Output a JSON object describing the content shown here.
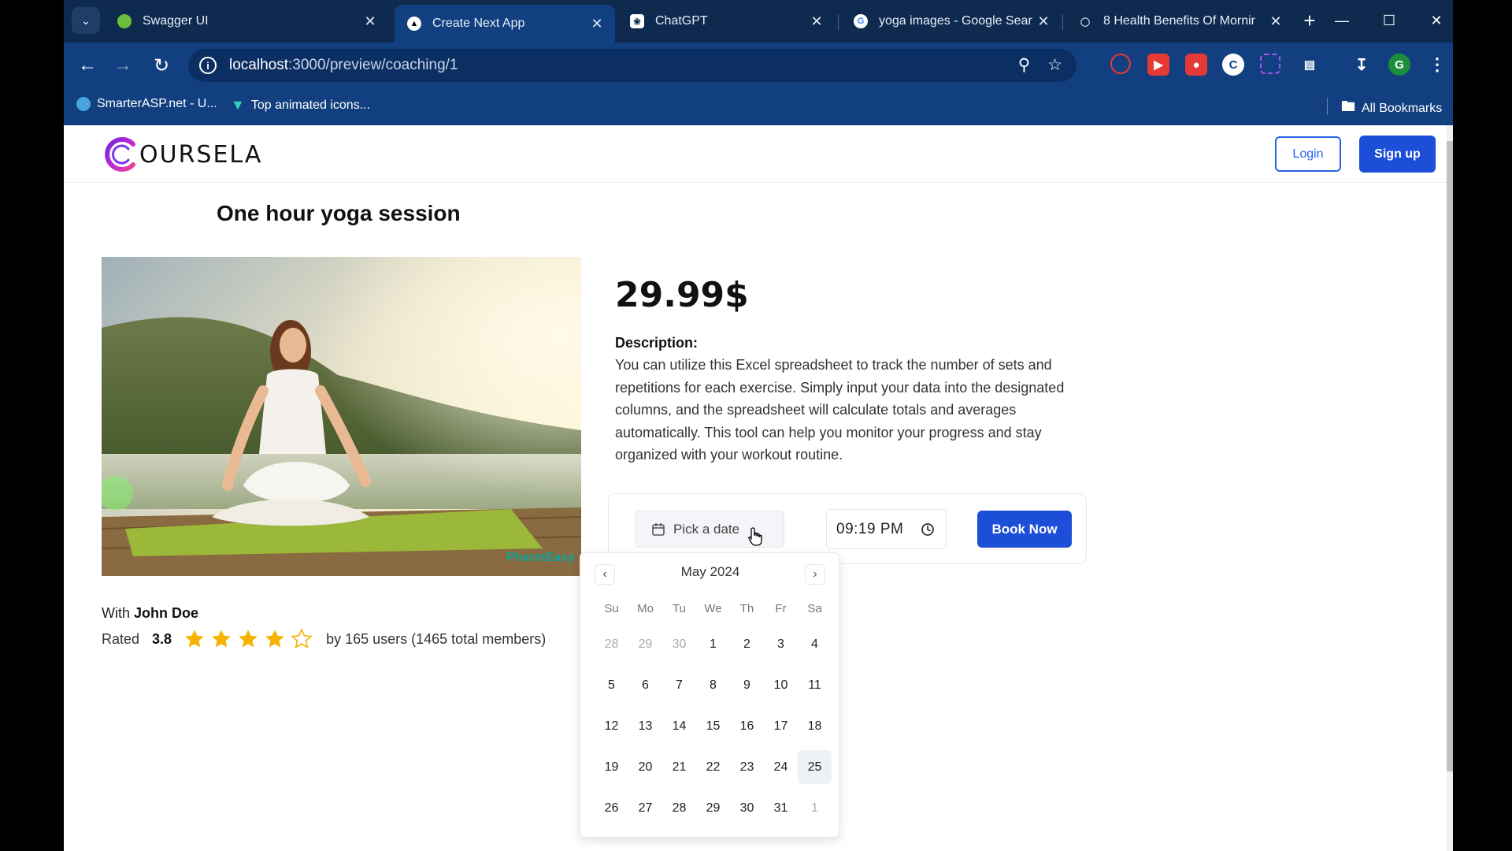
{
  "browser": {
    "tabs": [
      {
        "title": "Swagger UI",
        "active": false
      },
      {
        "title": "Create Next App",
        "active": true
      },
      {
        "title": "ChatGPT",
        "active": false
      },
      {
        "title": "yoga images - Google Sear",
        "active": false
      },
      {
        "title": "8 Health Benefits Of Mornir",
        "active": false
      }
    ],
    "url_host": "localhost",
    "url_path": ":3000/preview/coaching/1",
    "profile_initial": "G",
    "bookmarks": [
      {
        "label": "SmarterASP.net - U..."
      },
      {
        "label": "Top animated icons..."
      }
    ],
    "all_bookmarks": "All Bookmarks"
  },
  "site": {
    "logo_text": "OURSELA",
    "login": "Login",
    "signup": "Sign up"
  },
  "session": {
    "title": "One hour yoga session",
    "image_watermark": "PharmEasy",
    "price": "29.99$",
    "description_label": "Description:",
    "description": "You can utilize this Excel spreadsheet to track the number of sets and repetitions for each exercise. Simply input your data into the designated columns, and the spreadsheet will calculate totals and averages automatically. This tool can help you monitor your progress and stay organized with your workout routine.",
    "with_label": "With",
    "coach": "John Doe",
    "rated_label": "Rated",
    "rating": "3.8",
    "stars_filled": 4,
    "stars_total": 5,
    "rating_users": "by 165 users (1465 total members)"
  },
  "booking": {
    "date_placeholder": "Pick a date",
    "time_value": "09:19 PM",
    "book_button": "Book Now"
  },
  "calendar": {
    "month_label": "May 2024",
    "weekdays": [
      "Su",
      "Mo",
      "Tu",
      "We",
      "Th",
      "Fr",
      "Sa"
    ],
    "weeks": [
      [
        {
          "d": "28",
          "out": true
        },
        {
          "d": "29",
          "out": true
        },
        {
          "d": "30",
          "out": true
        },
        {
          "d": "1"
        },
        {
          "d": "2"
        },
        {
          "d": "3"
        },
        {
          "d": "4"
        }
      ],
      [
        {
          "d": "5"
        },
        {
          "d": "6"
        },
        {
          "d": "7"
        },
        {
          "d": "8"
        },
        {
          "d": "9"
        },
        {
          "d": "10"
        },
        {
          "d": "11"
        }
      ],
      [
        {
          "d": "12"
        },
        {
          "d": "13"
        },
        {
          "d": "14"
        },
        {
          "d": "15"
        },
        {
          "d": "16"
        },
        {
          "d": "17"
        },
        {
          "d": "18"
        }
      ],
      [
        {
          "d": "19"
        },
        {
          "d": "20"
        },
        {
          "d": "21"
        },
        {
          "d": "22"
        },
        {
          "d": "23"
        },
        {
          "d": "24"
        },
        {
          "d": "25",
          "today": true
        }
      ],
      [
        {
          "d": "26"
        },
        {
          "d": "27"
        },
        {
          "d": "28"
        },
        {
          "d": "29"
        },
        {
          "d": "30"
        },
        {
          "d": "31"
        },
        {
          "d": "1",
          "out": true
        }
      ]
    ]
  },
  "colors": {
    "accent": "#1d4ed8",
    "tabstrip": "#0f2a4f",
    "toolbar": "#123f80",
    "star": "#f5b301"
  }
}
